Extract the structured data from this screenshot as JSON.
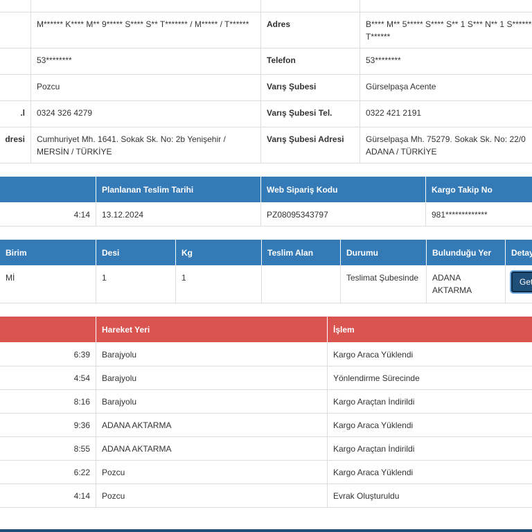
{
  "info": {
    "rows": [
      {
        "l_label": "",
        "l_value": "",
        "r_label": "",
        "r_value": ""
      },
      {
        "l_label": "",
        "l_value": "M****** K**** M** 9***** S**** S** T******* / M***** / T******",
        "r_label": "Adres",
        "r_value": "B**** M** 5***** S**** S** 1 S*** N** 1 S****** T******"
      },
      {
        "l_label": "",
        "l_value": "53********",
        "r_label": "Telefon",
        "r_value": "53********"
      },
      {
        "l_label": "",
        "l_value": "Pozcu",
        "r_label": "Varış Şubesi",
        "r_value": "Gürselpaşa Acente"
      },
      {
        "l_label": "l.",
        "l_value": "0324 326 4279",
        "r_label": "Varış Şubesi Tel.",
        "r_value": "0322 421 2191"
      },
      {
        "l_label": "dresi",
        "l_value": "Cumhuriyet Mh. 1641. Sokak Sk. No: 2b Yenişehir / MERSİN / TÜRKİYE",
        "r_label": "Varış Şubesi Adresi",
        "r_value": "Gürselpaşa Mh. 75279. Sokak Sk. No: 22/0 ADANA / TÜRKİYE"
      }
    ]
  },
  "order": {
    "headers": [
      "",
      "Planlanan Teslim Tarihi",
      "Web Sipariş Kodu",
      "Kargo Takip No"
    ],
    "row": [
      "4:14",
      "13.12.2024",
      "PZ08095343797",
      "981*************"
    ]
  },
  "shipment": {
    "headers": [
      "Birim",
      "Desi",
      "Kg",
      "Teslim Alan",
      "Durumu",
      "Bulunduğu Yer",
      "Detay"
    ],
    "row": {
      "birim": "Mİ",
      "desi": "1",
      "kg": "1",
      "teslim_alan": "",
      "durumu": "Teslimat Şubesinde",
      "yer": "ADANA AKTARMA",
      "button": "Getir"
    }
  },
  "movements": {
    "headers": [
      "",
      "Hareket Yeri",
      "İşlem"
    ],
    "rows": [
      {
        "time": "6:39",
        "place": "Barajyolu",
        "action": "Kargo Araca Yüklendi"
      },
      {
        "time": "4:54",
        "place": "Barajyolu",
        "action": "Yönlendirme Sürecinde"
      },
      {
        "time": "8:16",
        "place": "Barajyolu",
        "action": "Kargo Araçtan İndirildi"
      },
      {
        "time": "9:36",
        "place": "ADANA AKTARMA",
        "action": "Kargo Araca Yüklendi"
      },
      {
        "time": "8:55",
        "place": "ADANA AKTARMA",
        "action": "Kargo Araçtan İndirildi"
      },
      {
        "time": "6:22",
        "place": "Pozcu",
        "action": "Kargo Araca Yüklendi"
      },
      {
        "time": "4:14",
        "place": "Pozcu",
        "action": "Evrak Oluşturuldu"
      }
    ]
  },
  "colors": {
    "blue_header": "#337ab7",
    "red_header": "#d9534f",
    "button": "#1f4e79"
  }
}
